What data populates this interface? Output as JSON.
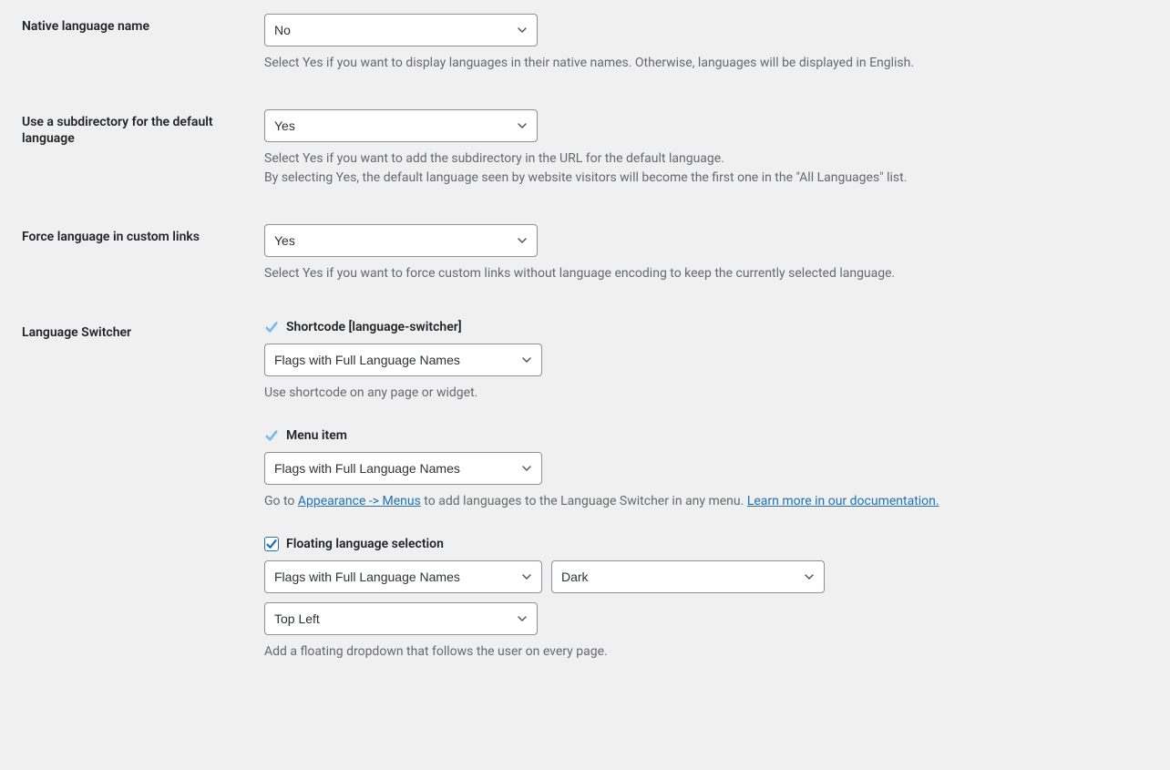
{
  "native_lang": {
    "label": "Native language name",
    "value": "No",
    "description": "Select Yes if you want to display languages in their native names. Otherwise, languages will be displayed in English."
  },
  "subdirectory": {
    "label": "Use a subdirectory for the default language",
    "value": "Yes",
    "desc_line1": "Select Yes if you want to add the subdirectory in the URL for the default language.",
    "desc_line2": "By selecting Yes, the default language seen by website visitors will become the first one in the \"All Languages\" list."
  },
  "force_links": {
    "label": "Force language in custom links",
    "value": "Yes",
    "description": "Select Yes if you want to force custom links without language encoding to keep the currently selected language."
  },
  "switcher": {
    "label": "Language Switcher",
    "shortcode": {
      "title": "Shortcode [language-switcher]",
      "value": "Flags with Full Language Names",
      "description": "Use shortcode on any page or widget."
    },
    "menu_item": {
      "title": "Menu item",
      "value": "Flags with Full Language Names",
      "desc_prefix": "Go to ",
      "link1": "Appearance -> Menus",
      "desc_mid": " to add languages to the Language Switcher in any menu. ",
      "link2": "Learn more in our documentation."
    },
    "floating": {
      "title": "Floating language selection",
      "value_style": "Flags with Full Language Names",
      "value_theme": "Dark",
      "value_position": "Top Left",
      "description": "Add a floating dropdown that follows the user on every page."
    }
  }
}
